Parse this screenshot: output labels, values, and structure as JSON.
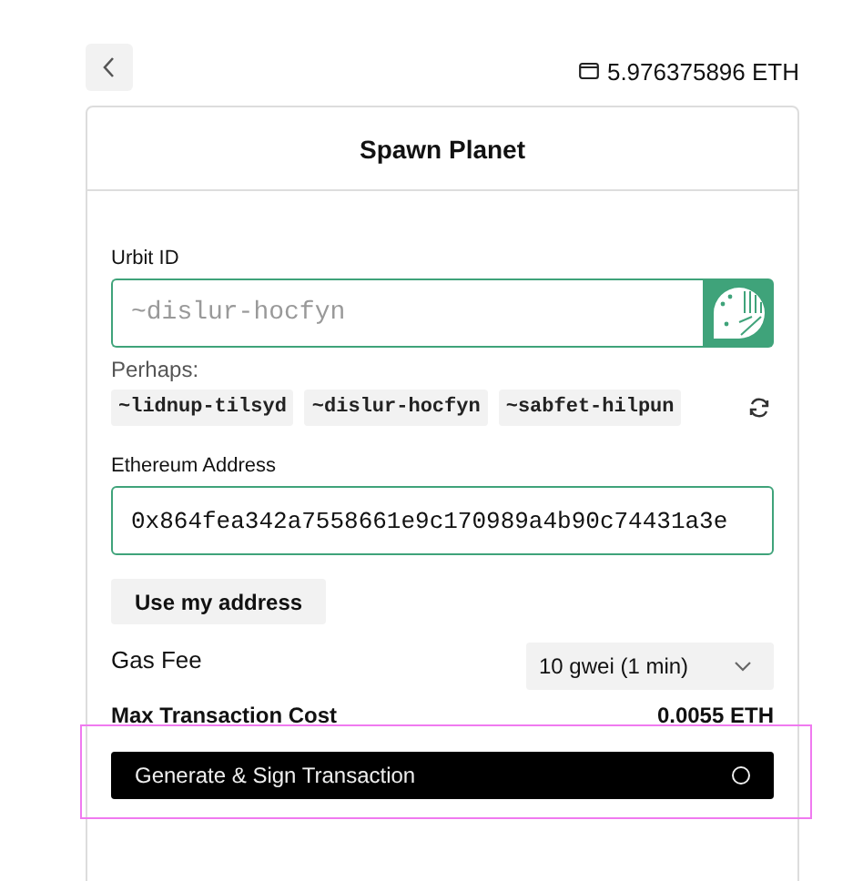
{
  "header": {
    "balance": "5.976375896 ETH"
  },
  "card": {
    "title": "Spawn Planet",
    "urbit_id": {
      "label": "Urbit ID",
      "placeholder": "~dislur-hocfyn"
    },
    "suggestions": {
      "label": "Perhaps:",
      "items": [
        "~lidnup-tilsyd",
        "~dislur-hocfyn",
        "~sabfet-hilpun"
      ]
    },
    "ethereum_address": {
      "label": "Ethereum Address",
      "value": "0x864fea342a7558661e9c170989a4b90c74431a3e"
    },
    "use_address_button": "Use my address",
    "gas_fee": {
      "label": "Gas Fee",
      "value": "10 gwei (1 min)"
    },
    "max_cost": {
      "label": "Max Transaction Cost",
      "value": "0.0055 ETH"
    },
    "submit_button": "Generate & Sign Transaction"
  }
}
